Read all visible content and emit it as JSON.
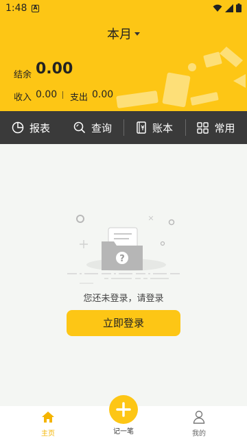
{
  "status_bar": {
    "time": "1:48",
    "notification_icon": "a-square-icon",
    "icons": [
      "wifi-icon",
      "signal-icon",
      "battery-icon"
    ]
  },
  "header": {
    "month_title": "本月",
    "balance_label": "结余",
    "balance_value": "0.00",
    "income_label": "收入",
    "income_value": "0.00",
    "expense_label": "支出",
    "expense_value": "0.00",
    "background_color": "#fdc615"
  },
  "toolbar": {
    "items": [
      {
        "label": "报表",
        "icon": "pie-chart-icon"
      },
      {
        "label": "查询",
        "icon": "search-icon"
      },
      {
        "label": "账本",
        "icon": "ledger-icon"
      },
      {
        "label": "常用",
        "icon": "grid-icon"
      }
    ],
    "background_color": "#3a3a3a"
  },
  "empty_state": {
    "message": "您还未登录，请登录",
    "login_button": "立即登录"
  },
  "tabbar": {
    "home_label": "主页",
    "add_label": "记一笔",
    "mine_label": "我的",
    "active_color": "#f4b400"
  }
}
